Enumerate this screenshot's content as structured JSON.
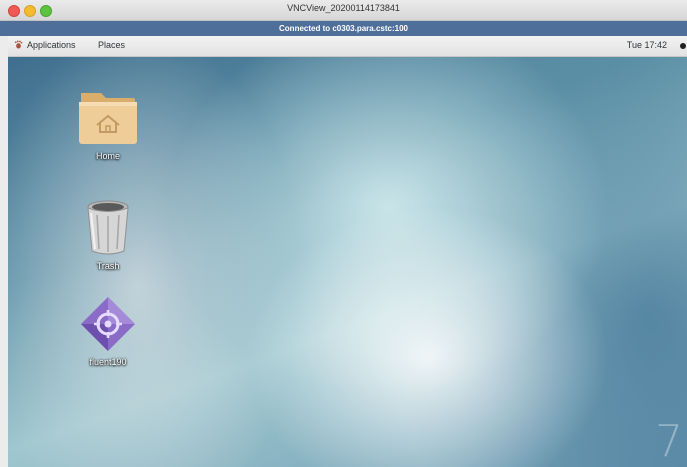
{
  "window": {
    "title": "VNCView_20200114173841",
    "banner": "Connected to c0303.para.cstc:100"
  },
  "panel": {
    "applications_label": "Applications",
    "places_label": "Places",
    "clock": "Tue 17:42"
  },
  "desktop": {
    "icons": [
      {
        "label": "Home",
        "icon": "home-folder-icon"
      },
      {
        "label": "Trash",
        "icon": "trash-icon"
      },
      {
        "label": "fluent190",
        "icon": "application-icon"
      }
    ],
    "watermark": "7"
  },
  "colors": {
    "banner": "#4e6f9a",
    "folder": "#e9c48a",
    "app_icon": "#8a6bc7"
  }
}
